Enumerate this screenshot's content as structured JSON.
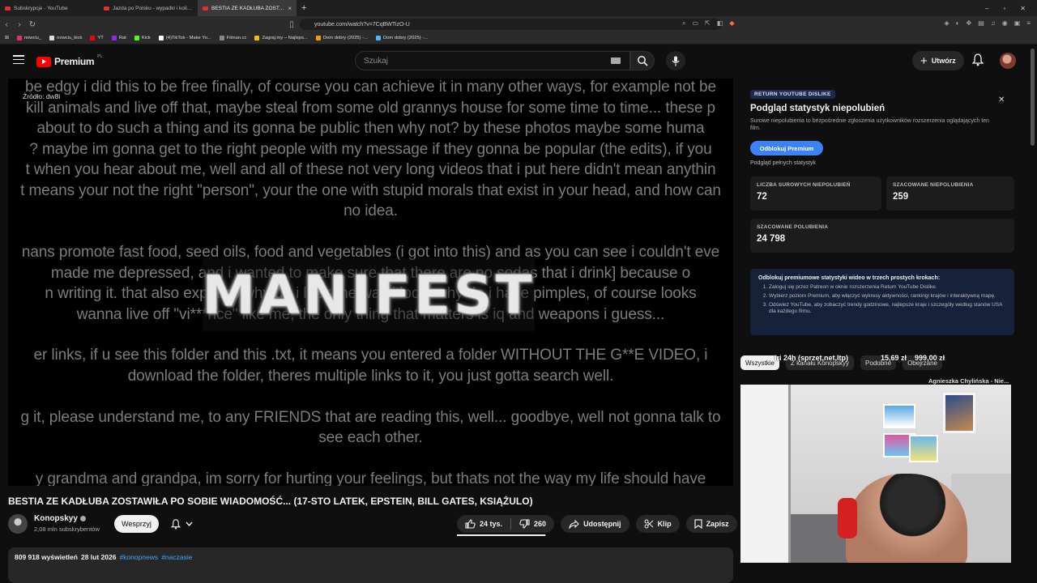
{
  "browser": {
    "tabs": [
      {
        "title": "Subskrypcje - YouTube",
        "active": false
      },
      {
        "title": "Jazda po Polsku - wypadki i kolizje o...",
        "active": false
      },
      {
        "title": "BESTIA ZE KADŁUBA ZOSTAWI...",
        "active": true
      }
    ],
    "new_tab": "+",
    "url": "youtube.com/watch?v=7CqBWTizO-U",
    "bookmarks": [
      {
        "label": "nowciu_",
        "color": "#e1306c"
      },
      {
        "label": "nowciu_kick",
        "color": "#dddddd"
      },
      {
        "label": "YT",
        "color": "#ff0000"
      },
      {
        "label": "Rat",
        "color": "#8a2be2"
      },
      {
        "label": "Kick",
        "color": "#53fc18"
      },
      {
        "label": "(4)TikTok - Make Yo...",
        "color": "#ffffff"
      },
      {
        "label": "Filman.cc",
        "color": "#888888"
      },
      {
        "label": "Zagraj.my – Najleps...",
        "color": "#f0c000"
      },
      {
        "label": "Dom dobry (2025) -...",
        "color": "#f0a000"
      },
      {
        "label": "Dom dobry (2025) -...",
        "color": "#4db6ff"
      }
    ]
  },
  "masthead": {
    "logo_text": "Premium",
    "logo_country": "PL",
    "search_placeholder": "Szukaj",
    "create_label": "Utwórz"
  },
  "player": {
    "source_label": "Źródło: dw8i",
    "overlay_title": "MANIFEST",
    "lines": [
      "be edgy i did this to be free finally, of course you can achieve it in many other ways, for example not be",
      "kill animals and live off that, maybe steal from some old grannys house for some time to time...  these p",
      "about to do such a thing and its gonna be public then why not? by these photos maybe some huma",
      "? maybe im gonna get to the right people with my message if they gonna be popular (the edits), if you",
      "t when you hear about me, well and all of these not very long videos that i put here didn't mean anythin",
      "t means your not the right \"person\", your the one with stupid morals that exist in your head, and how can",
      "no idea.",
      "nans promote fast food, seed oils, food and vegetables (i got into this) and as you can see i couldn't eve",
      "made me depressed, and i wanted to make sure that there are no sodas that i drink] because o",
      "n writing it. that also explains why do i look the way i look, why do i have pimples, of course looks",
      "wanna live off \"vi***nce\" like me, the only thing that matters is iq and weapons i guess...",
      "er links, if u see this folder and this .txt, it means you entered a folder WITHOUT THE G**E VIDEO, i",
      "download the folder, theres multiple links to it, you just gotta search well.",
      "g it, please understand me, to any FRIENDS that are reading this, well... goodbye, well not gonna talk to",
      "see each other.",
      "y grandma and grandpa, im sorry for hurting your feelings, but thats not the way my life should have"
    ]
  },
  "video": {
    "title": "BESTIA ZE KADŁUBA ZOSTAWIŁA PO SOBIE WIADOMOŚĆ... (17-STO LATEK, EPSTEIN, BILL GATES, KSIĄŻULO)",
    "channel": "Konopskyy",
    "subscribers": "2,08 mln subskrybentów",
    "support_label": "Wesprzyj",
    "likes": "24 tys.",
    "dislikes": "260",
    "like_ratio": 0.99,
    "share_label": "Udostępnij",
    "clip_label": "Klip",
    "save_label": "Zapisz",
    "views": "809 918 wyświetleń",
    "date": "28 lut 2026",
    "hashtags": [
      "#konopnews",
      "#naczasie"
    ]
  },
  "ryd": {
    "badge": "RETURN YOUTUBE DISLIKE",
    "title": "Podgląd statystyk niepolubień",
    "subtitle": "Surowe niepolubienia to bezpośrednie zgłoszenia użytkowników rozszerzenia oglądających ten film.",
    "unlock_label": "Odblokuj Premium",
    "preview_text": "Podgląd pełnych statystyk",
    "raw_label": "LICZBA SUROWYCH NIEPOLUBIEŃ",
    "raw_value": "72",
    "est_label": "SZACOWANE NIEPOLUBIENIA",
    "est_value": "259",
    "likes_label": "SZACOWANE POLUBIENIA",
    "likes_value": "24 798",
    "promo_head": "Odblokuj premiumowe statystyki wideo w trzech prostych krokach:",
    "promo_steps": [
      "Zaloguj się przez Patreon w oknie rozszerzenia Return YouTube Dislike.",
      "Wybierz poziom Premium, aby włączyć wykresy aktywności, rankingi krajów i interaktywną mapę.",
      "Odśwież YouTube, aby zobaczyć trendy godzinowe, najlepsze kraje i szczegóły według stanów USA dla każdego filmu."
    ]
  },
  "chips": {
    "all": "Wszystkie",
    "from_channel": "Z kanału Konopskyy",
    "similar": "Podobne",
    "watched": "Obejrzane"
  },
  "stream_overlay": {
    "left": "iri 24h (sprzet,net,ltp)",
    "price1": "15,69 zł",
    "price2": "999,00 zł",
    "label": "Agnieszka Chylińska - Nie..."
  }
}
